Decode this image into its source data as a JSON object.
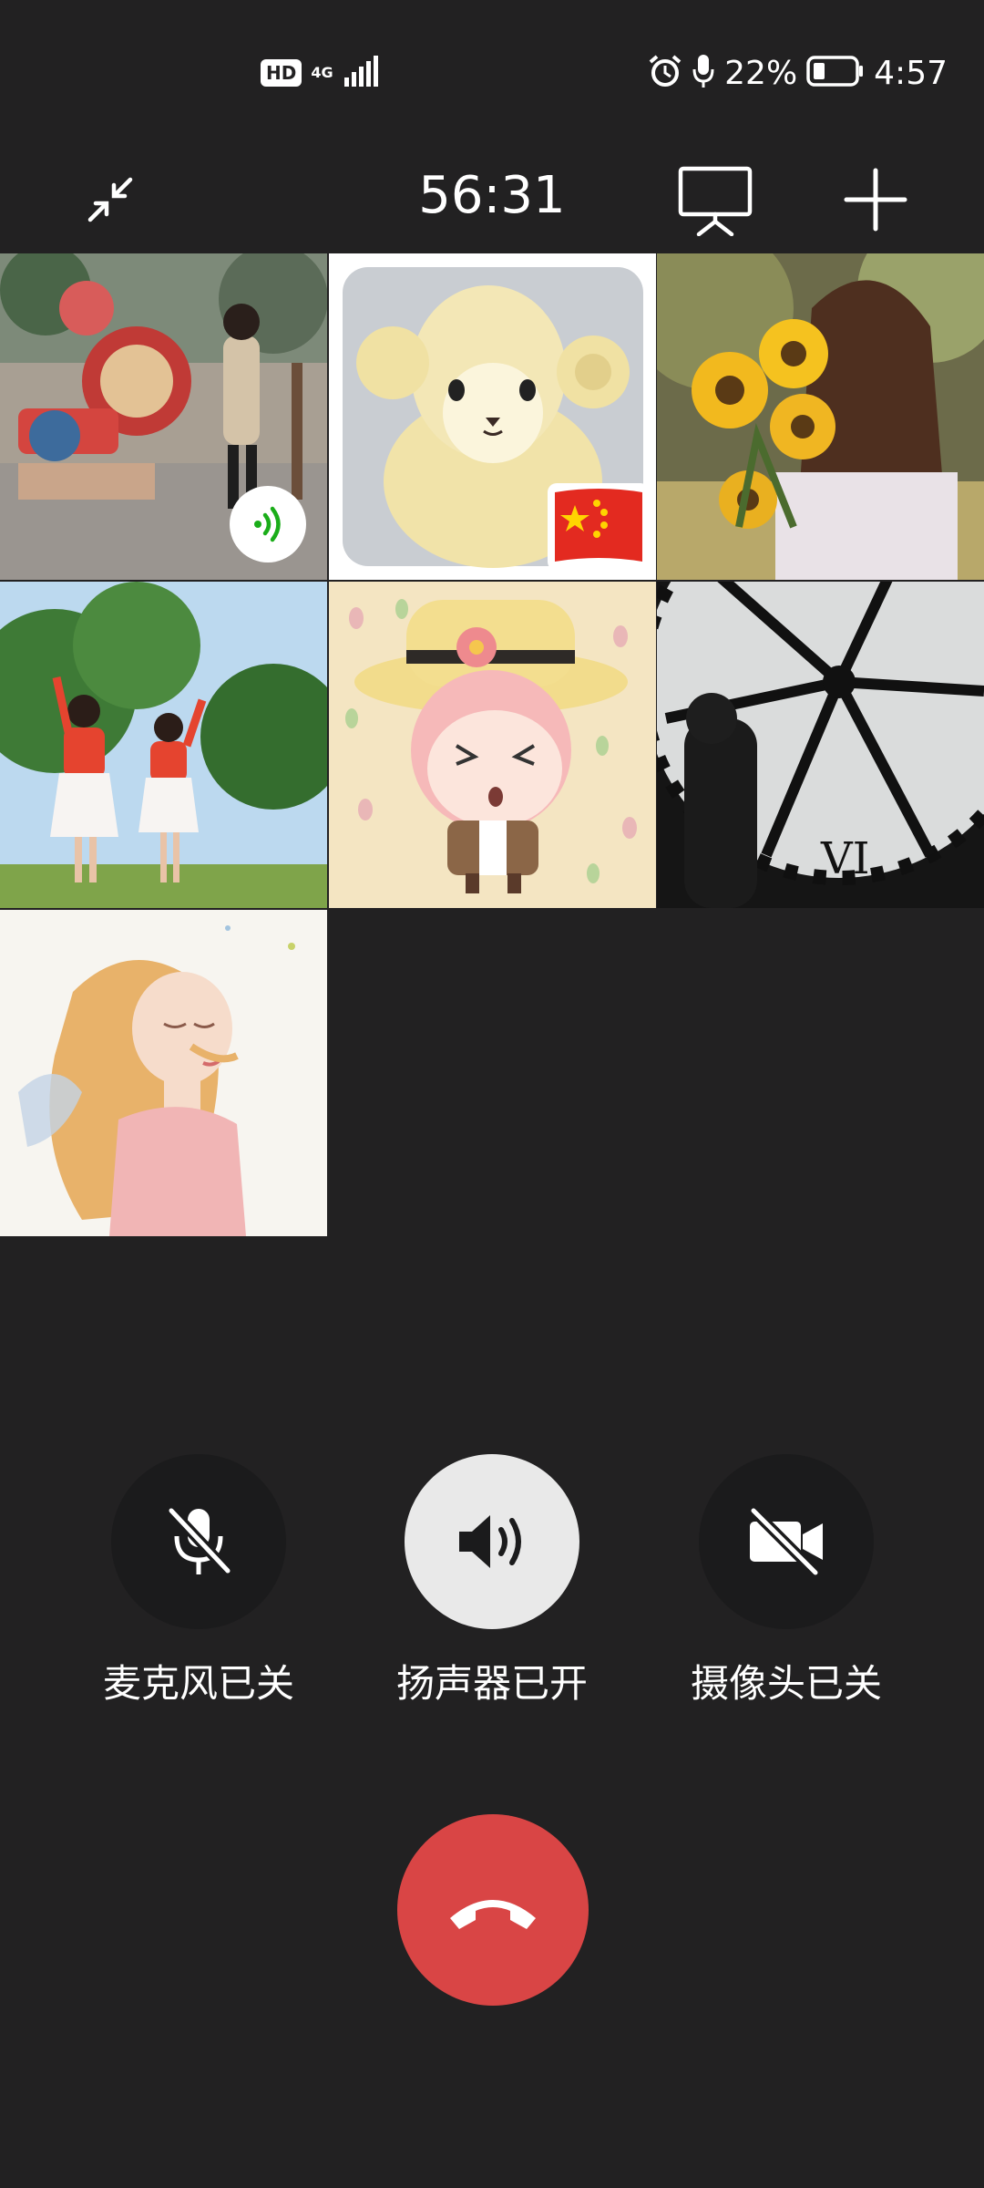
{
  "status_bar": {
    "hd": "HD",
    "network": "4G",
    "battery_percent": "22%",
    "time": "4:57"
  },
  "header": {
    "timer": "56:31"
  },
  "participants": [
    {
      "id": 1,
      "speaking": true
    },
    {
      "id": 2,
      "flag": "china-flag-icon"
    },
    {
      "id": 3
    },
    {
      "id": 4
    },
    {
      "id": 5
    },
    {
      "id": 6
    },
    {
      "id": 7
    }
  ],
  "controls": {
    "mic_label": "麦克风已关",
    "speaker_label": "扬声器已开",
    "camera_label": "摄像头已关"
  },
  "colors": {
    "background": "#222122",
    "hangup": "#d94545",
    "speaking": "#1aad19"
  }
}
